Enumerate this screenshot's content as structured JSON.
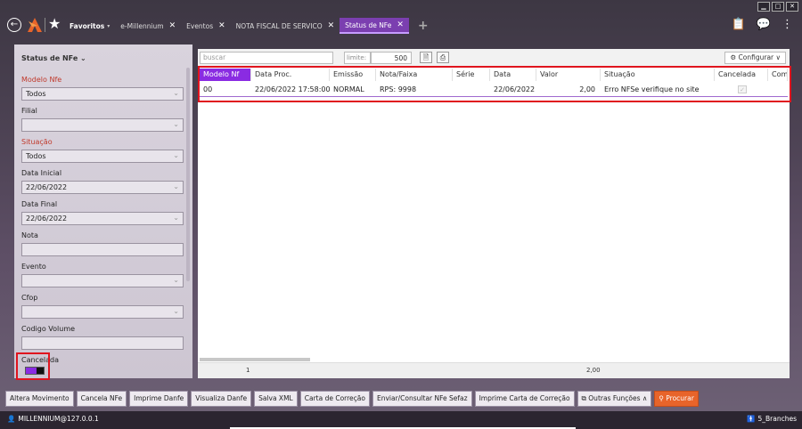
{
  "window": {
    "minimize": "▁",
    "maximize": "□",
    "close": "✕"
  },
  "tabs": [
    {
      "label": "Favoritos",
      "kind": "favorites"
    },
    {
      "label": "e-Millennium",
      "closable": true
    },
    {
      "label": "Eventos",
      "closable": true
    },
    {
      "label": "NOTA FISCAL DE SERVICO",
      "closable": true
    },
    {
      "label": "Status de NFe",
      "closable": true,
      "active": true
    }
  ],
  "left_panel": {
    "title": "Status de NFe",
    "fields": {
      "modelo_nfe": {
        "label": "Modelo Nfe",
        "value": "Todos"
      },
      "filial": {
        "label": "Filial",
        "value": ""
      },
      "situacao": {
        "label": "Situação",
        "value": "Todos"
      },
      "data_inicial": {
        "label": "Data Inicial",
        "value": "22/06/2022"
      },
      "data_final": {
        "label": "Data Final",
        "value": "22/06/2022"
      },
      "nota": {
        "label": "Nota",
        "value": ""
      },
      "evento": {
        "label": "Evento",
        "value": ""
      },
      "cfop": {
        "label": "Cfop",
        "value": ""
      },
      "codigo_volume": {
        "label": "Codigo Volume",
        "value": ""
      },
      "cancelada": {
        "label": "Cancelada"
      }
    }
  },
  "toolbar": {
    "search_placeholder": "buscar",
    "limit_label": "limite:",
    "limit_value": "500",
    "configurar": "⚙ Configurar ∨"
  },
  "grid": {
    "columns": [
      "Modelo Nf",
      "Data Proc.",
      "Emissão",
      "Nota/Faixa",
      "Série",
      "Data",
      "Valor",
      "Situação",
      "Cancelada",
      "Comp"
    ],
    "row": {
      "modelo": "00",
      "data_proc": "22/06/2022 17:58:00",
      "emissao": "NORMAL",
      "nota_faixa": "RPS: 9998",
      "serie": "",
      "data": "22/06/2022",
      "valor": "2,00",
      "situacao": "Erro NFSe verifique no site",
      "cancelada": "✓"
    },
    "footer_count": "1",
    "footer_total": "2,00"
  },
  "bottom_buttons": {
    "altera_movimento": "Altera Movimento",
    "cancela_nfe": "Cancela NFe",
    "imprime_danfe": "Imprime Danfe",
    "visualiza_danfe": "Visualiza Danfe",
    "salva_xml": "Salva XML",
    "carta_correcao": "Carta de Correção",
    "enviar_consultar": "Enviar/Consultar NFe Sefaz",
    "imprime_carta": "Imprime Carta de Correção",
    "outras_funcoes": "Outras Funções ∧",
    "procurar": "Procurar"
  },
  "status": {
    "user": "MILLENNIUM@127.0.0.1",
    "branch": "5_Branches"
  },
  "colors": {
    "accent": "#8a2be2",
    "highlight": "#e0141e",
    "procurar": "#e8642a"
  }
}
